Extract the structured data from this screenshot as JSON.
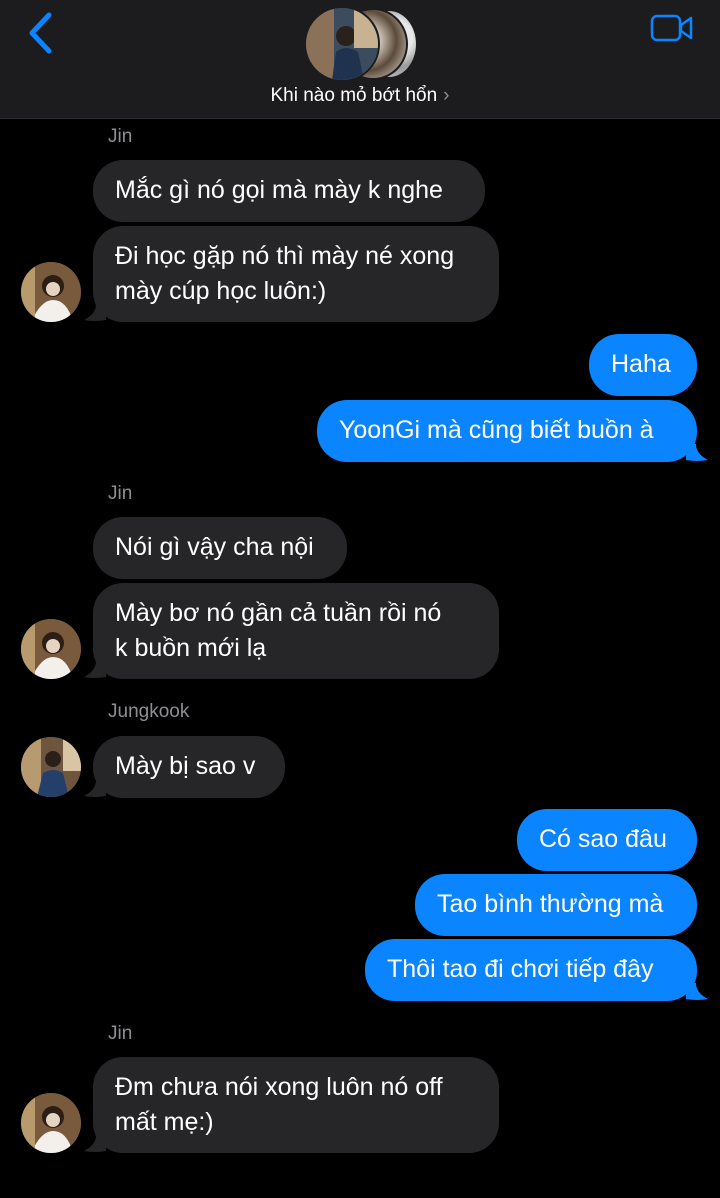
{
  "header": {
    "group_name": "Khi nào mỏ bớt hổn",
    "chevron": "›",
    "back_icon": "chevron-left-icon",
    "video_icon": "video-camera-icon",
    "accent": "#0a84ff"
  },
  "messages": {
    "jin_1": "Jin",
    "m1": "Mắc gì nó gọi mà mày k nghe",
    "m2_line1": "Đi học gặp nó thì mày né xong",
    "m2_line2": "mày cúp học luôn:)",
    "m3": "Haha",
    "m4": "YoonGi mà cũng biết buồn à",
    "jin_2": "Jin",
    "m5": "Nói gì vậy cha nội",
    "m6_line1": "Mày bơ nó gần cả tuần rồi nó",
    "m6_line2": "k buồn mới lạ",
    "jk_1": "Jungkook",
    "m7": "Mày bị sao v",
    "m8": "Có sao đâu",
    "m9": "Tao bình thường mà",
    "m10": "Thôi tao đi chơi tiếp đây",
    "jin_3": "Jin",
    "m11_line1": "Đm chưa nói xong luôn nó off",
    "m11_line2": "mất mẹ:)"
  },
  "colors": {
    "incoming_bubble": "#262628",
    "outgoing_bubble": "#0a84ff",
    "background": "#000000",
    "header_bg": "#1c1c1e"
  }
}
